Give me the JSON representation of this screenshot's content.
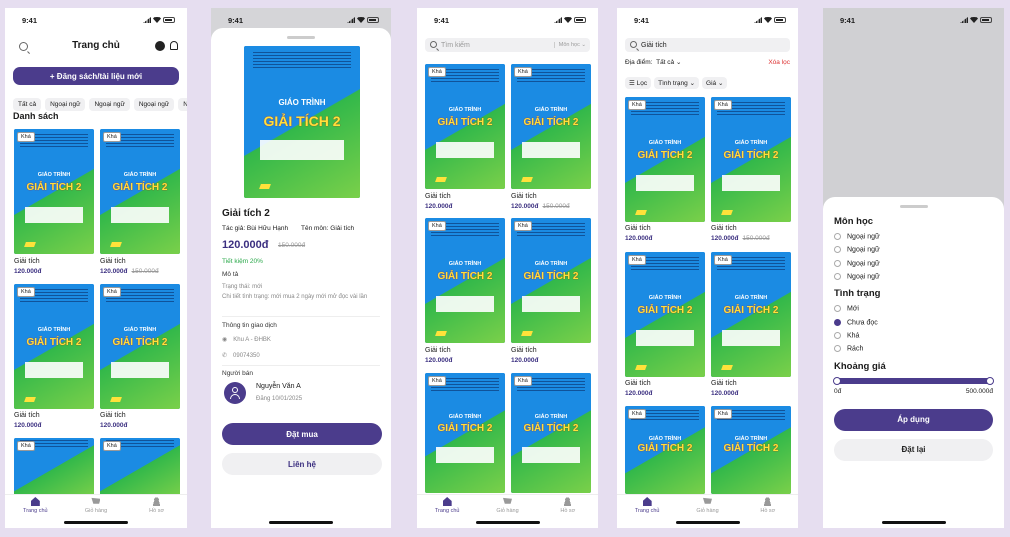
{
  "status_time": "9:41",
  "s1": {
    "title": "Trang chủ",
    "post_btn": "+ Đăng sách/tài liệu mới",
    "chips": [
      "Tất cả",
      "Ngoại ngữ",
      "Ngoại ngữ",
      "Ngoại ngữ",
      "N"
    ],
    "section": "Danh sách",
    "items": [
      {
        "name": "Giải tích",
        "price": "120.000đ",
        "old": ""
      },
      {
        "name": "Giải tích",
        "price": "120.000đ",
        "old": "150.000đ"
      },
      {
        "name": "Giải tích",
        "price": "120.000đ",
        "old": ""
      },
      {
        "name": "Giải tích",
        "price": "120.000đ",
        "old": ""
      }
    ]
  },
  "book": {
    "tag": "Khá",
    "line1": "GIÁO TRÌNH",
    "line2": "GIẢI TÍCH 2"
  },
  "tabs": {
    "home": "Trang chủ",
    "cart": "Giỏ hàng",
    "profile": "Hồ sơ"
  },
  "s2": {
    "title": "Giải tích 2",
    "author": "Tác giả: Bùi Hữu Hạnh",
    "subject": "Tên môn: Giải tích",
    "price": "120.000đ",
    "old": "150.000đ",
    "save": "Tiết kiệm 20%",
    "desc_h": "Mô tả",
    "state": "Trạng thái: mới",
    "detail": "Chi tiết tình trạng: mới mua 2 ngày mới mở đọc vài lần",
    "trade_h": "Thông tin giao dịch",
    "place": "Khu A - ĐHBK",
    "phone": "09074350",
    "seller_h": "Người bán",
    "seller": "Nguyễn Văn A",
    "posted": "Đăng 10/01/2025",
    "buy": "Đặt mua",
    "contact": "Liên hệ"
  },
  "s3": {
    "placeholder": "Tìm kiếm",
    "subject": "Môn học",
    "items": [
      {
        "name": "Giải tích",
        "price": "120.000đ",
        "old": ""
      },
      {
        "name": "Giải tích",
        "price": "120.000đ",
        "old": "150.000đ"
      },
      {
        "name": "Giải tích",
        "price": "120.000đ",
        "old": ""
      },
      {
        "name": "Giải tích",
        "price": "120.000đ",
        "old": ""
      }
    ]
  },
  "s4": {
    "query": "Giải tích",
    "loc_lbl": "Địa điểm:",
    "loc": "Tất cả",
    "clear": "Xóa lọc",
    "filter": "Lọc",
    "status": "Tình trạng",
    "price": "Giá",
    "items": [
      {
        "name": "Giải tích",
        "price": "120.000đ",
        "old": ""
      },
      {
        "name": "Giải tích",
        "price": "120.000đ",
        "old": "150.000đ"
      },
      {
        "name": "Giải tích",
        "price": "120.000đ",
        "old": ""
      },
      {
        "name": "Giải tích",
        "price": "120.000đ",
        "old": ""
      }
    ]
  },
  "s5": {
    "subj_h": "Môn học",
    "subjects": [
      "Ngoại ngữ",
      "Ngoại ngữ",
      "Ngoại ngữ",
      "Ngoại ngữ"
    ],
    "cond_h": "Tình trạng",
    "conds": [
      "Mới",
      "Chưa đọc",
      "Khá",
      "Rách"
    ],
    "cond_selected": 1,
    "price_h": "Khoảng giá",
    "min": "0đ",
    "max": "500.000đ",
    "apply": "Áp dụng",
    "reset": "Đặt lại"
  }
}
